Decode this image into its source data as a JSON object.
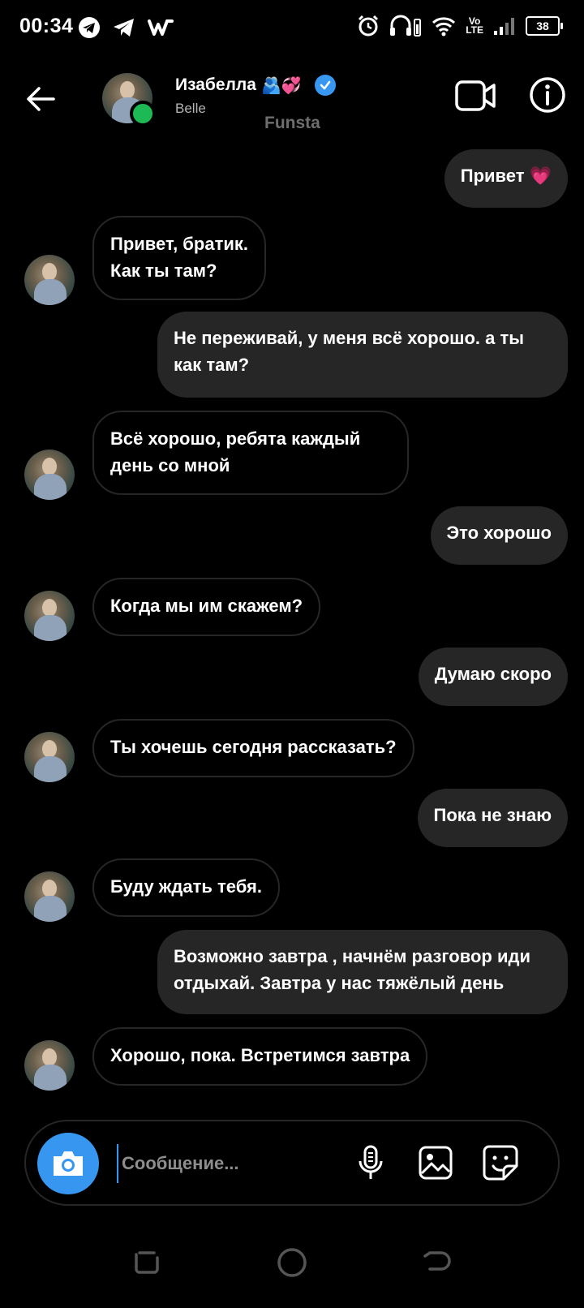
{
  "status_bar": {
    "time": "00:34",
    "network_label": "Vo\nLTE",
    "battery": "38"
  },
  "header": {
    "name": "Изабелла",
    "name_emojis": "🫂💞",
    "subtitle": "Belle",
    "funsta": "Funsta"
  },
  "messages": [
    {
      "dir": "out",
      "text": "Привет 💗"
    },
    {
      "dir": "in",
      "text": "Привет, братик.\nКак ты там?"
    },
    {
      "dir": "out",
      "text": "Не переживай, у меня всё хорошо. а ты как там?"
    },
    {
      "dir": "in",
      "text": "Всё хорошо, ребята каждый день со мной"
    },
    {
      "dir": "out",
      "text": "Это хорошо"
    },
    {
      "dir": "in",
      "text": "Когда мы им скажем?"
    },
    {
      "dir": "out",
      "text": "Думаю скоро"
    },
    {
      "dir": "in",
      "text": "Ты хочешь сегодня рассказать?"
    },
    {
      "dir": "out",
      "text": "Пока не знаю"
    },
    {
      "dir": "in",
      "text": "Буду ждать тебя."
    },
    {
      "dir": "out",
      "text": "Возможно завтра , начнём разговор иди отдыхай. Завтра у нас тяжёлый день"
    },
    {
      "dir": "in",
      "text": "Хорошо, пока. Встретимся завтра"
    }
  ],
  "composer": {
    "placeholder": "Сообщение..."
  },
  "colors": {
    "accent": "#3797f0",
    "bubble_out": "#262626",
    "online": "#1db954"
  }
}
